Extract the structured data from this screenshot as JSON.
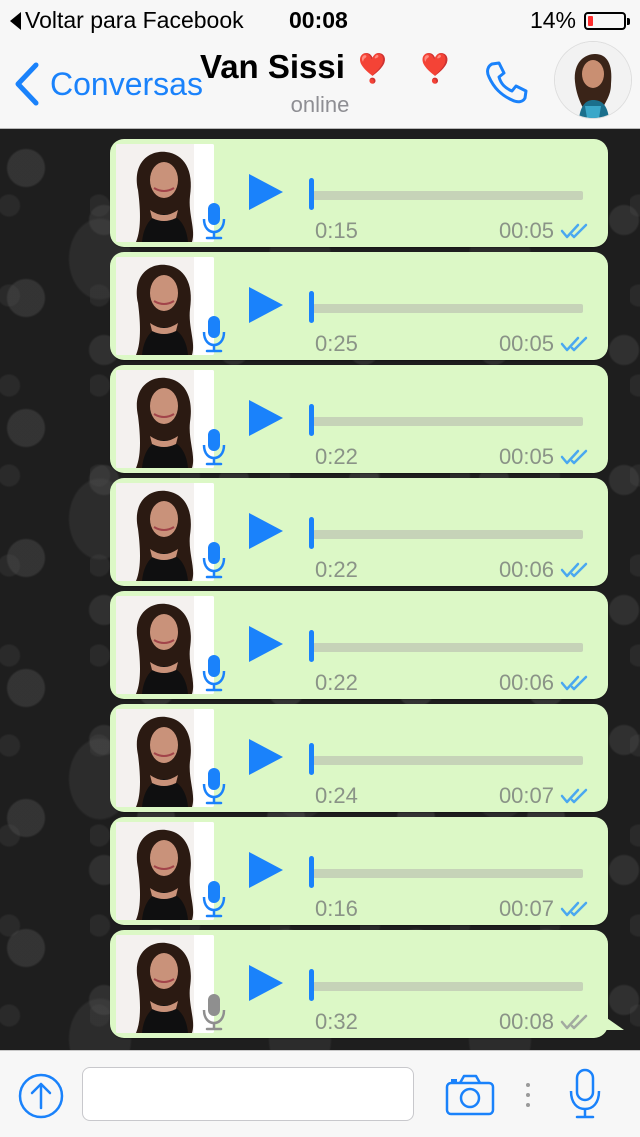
{
  "status_bar": {
    "back_app": "Voltar para Facebook",
    "time": "00:08",
    "battery": "14%",
    "battery_level": 0.14
  },
  "nav": {
    "back_label": "Conversas",
    "contact_name": "Van Sissi",
    "contact_emoji": "❣️ ❣️",
    "contact_status": "online"
  },
  "messages": [
    {
      "duration": "0:15",
      "time": "00:05",
      "status": "read",
      "mic": "blue"
    },
    {
      "duration": "0:25",
      "time": "00:05",
      "status": "read",
      "mic": "blue"
    },
    {
      "duration": "0:22",
      "time": "00:05",
      "status": "read",
      "mic": "blue"
    },
    {
      "duration": "0:22",
      "time": "00:06",
      "status": "read",
      "mic": "blue"
    },
    {
      "duration": "0:22",
      "time": "00:06",
      "status": "read",
      "mic": "blue"
    },
    {
      "duration": "0:24",
      "time": "00:07",
      "status": "read",
      "mic": "blue"
    },
    {
      "duration": "0:16",
      "time": "00:07",
      "status": "read",
      "mic": "blue"
    },
    {
      "duration": "0:32",
      "time": "00:08",
      "status": "delivered",
      "mic": "gray"
    }
  ],
  "input": {
    "placeholder": ""
  },
  "colors": {
    "accent": "#1a82fb",
    "bubble": "#dcf8c6",
    "battery_low": "#ff2d2d"
  }
}
